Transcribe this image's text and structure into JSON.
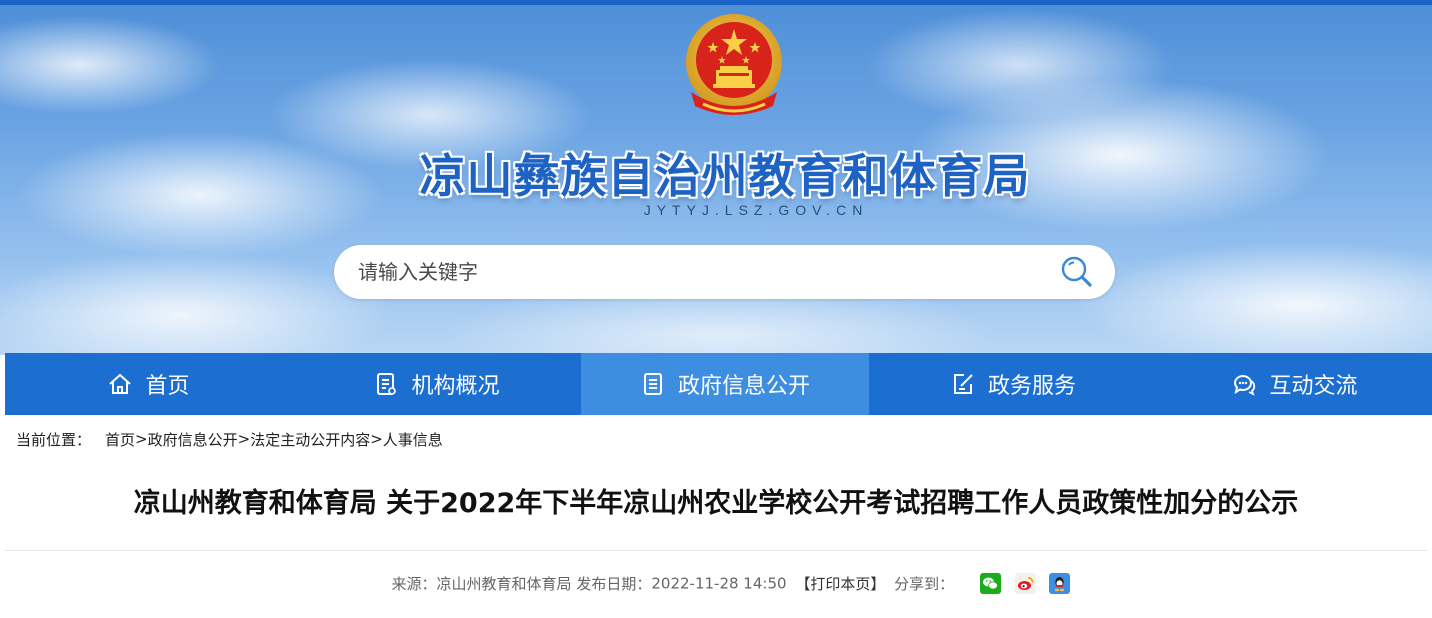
{
  "header": {
    "site_title": "凉山彝族自治州教育和体育局",
    "site_domain": "JYTYJ.LSZ.GOV.CN",
    "search_placeholder": "请输入关键字"
  },
  "nav": {
    "items": [
      {
        "label": "首页",
        "icon": "home-icon"
      },
      {
        "label": "机构概况",
        "icon": "document-list-icon"
      },
      {
        "label": "政府信息公开",
        "icon": "info-document-icon",
        "active": true
      },
      {
        "label": "政务服务",
        "icon": "edit-form-icon"
      },
      {
        "label": "互动交流",
        "icon": "chat-bubbles-icon"
      }
    ]
  },
  "breadcrumb": {
    "prefix": "当前位置：",
    "items": [
      "首页",
      "政府信息公开",
      "法定主动公开内容",
      "人事信息"
    ],
    "separator": ">"
  },
  "article": {
    "title": "凉山州教育和体育局 关于2022年下半年凉山州农业学校公开考试招聘工作人员政策性加分的公示",
    "source_label": "来源：",
    "source": "凉山州教育和体育局",
    "date_label": "发布日期：",
    "date": "2022-11-28 14:50",
    "print_label": "【打印本页】",
    "share_label": "分享到：",
    "share_icons": [
      "wechat-icon",
      "weibo-icon",
      "qq-icon"
    ]
  },
  "colors": {
    "nav_bg": "#1c6fd1",
    "nav_active_bg": "#3d8ee0",
    "title_blue": "#1e63c3",
    "top_bar": "#1a63c7"
  }
}
